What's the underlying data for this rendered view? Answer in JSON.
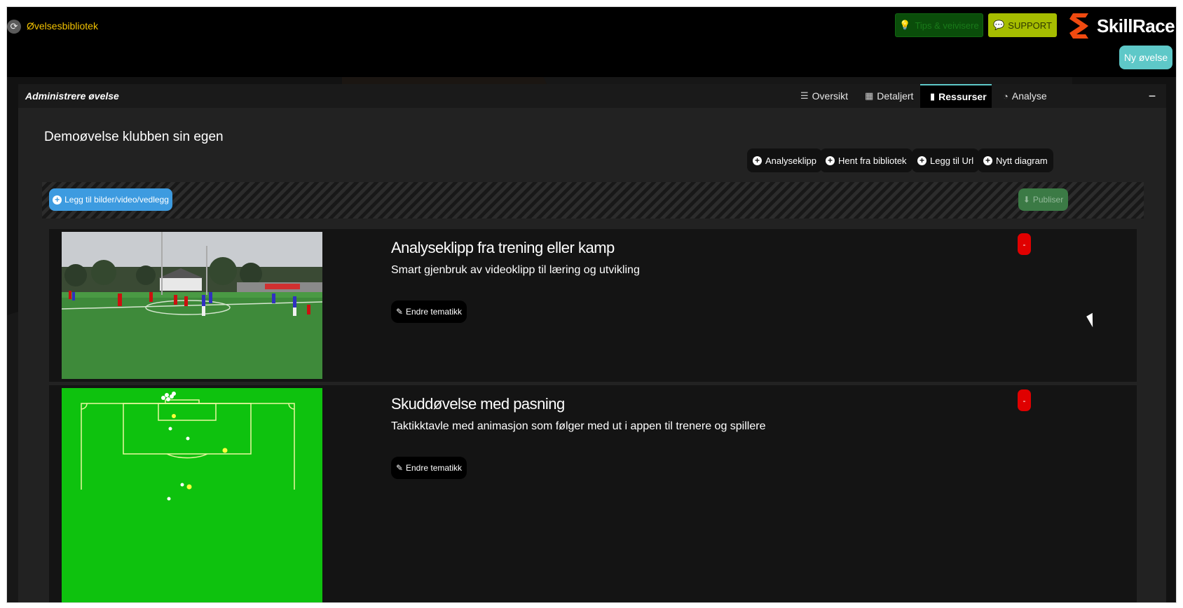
{
  "topbar": {
    "breadcrumb": "Øvelsesbibliotek",
    "tips_label": "Tips & veivisere",
    "support_label": "SUPPORT",
    "logo_text": "SkillRace",
    "new_exercise_label": "Ny øvelse"
  },
  "panel": {
    "title": "Administrere øvelse",
    "tabs": [
      {
        "label": "Oversikt",
        "icon": "list-icon"
      },
      {
        "label": "Detaljert",
        "icon": "calendar-icon"
      },
      {
        "label": "Ressurser",
        "icon": "clipboard-icon",
        "active": true
      },
      {
        "label": "Analyse",
        "icon": "clock-icon"
      }
    ],
    "collapse_label": "−"
  },
  "exercise": {
    "title": "Demoøvelse klubben sin egen"
  },
  "actions": {
    "analyseklipp": "Analyseklipp",
    "hent": "Hent fra bibliotek",
    "url": "Legg til Url",
    "diagram": "Nytt diagram"
  },
  "dropzone": {
    "add_label": "Legg til bilder/video/vedlegg",
    "publish_label": "Publiser"
  },
  "resources": [
    {
      "title": "Analyseklipp fra trening eller kamp",
      "subtitle": "Smart gjenbruk av videoklipp til læring og utvikling",
      "edit_label": "Endre tematikk",
      "delete_label": "-"
    },
    {
      "title": "Skuddøvelse med pasning",
      "subtitle": "Taktikktavle med animasjon som følger med ut i appen til trenere og spillere",
      "edit_label": "Endre tematikk",
      "delete_label": "-"
    }
  ],
  "colors": {
    "accent": "#5ec8c8",
    "breadcrumb": "#f2c200",
    "support": "#a6bd00",
    "add_button": "#3d9be0",
    "delete_button": "#e00000",
    "pitch": "#0ec20e"
  }
}
